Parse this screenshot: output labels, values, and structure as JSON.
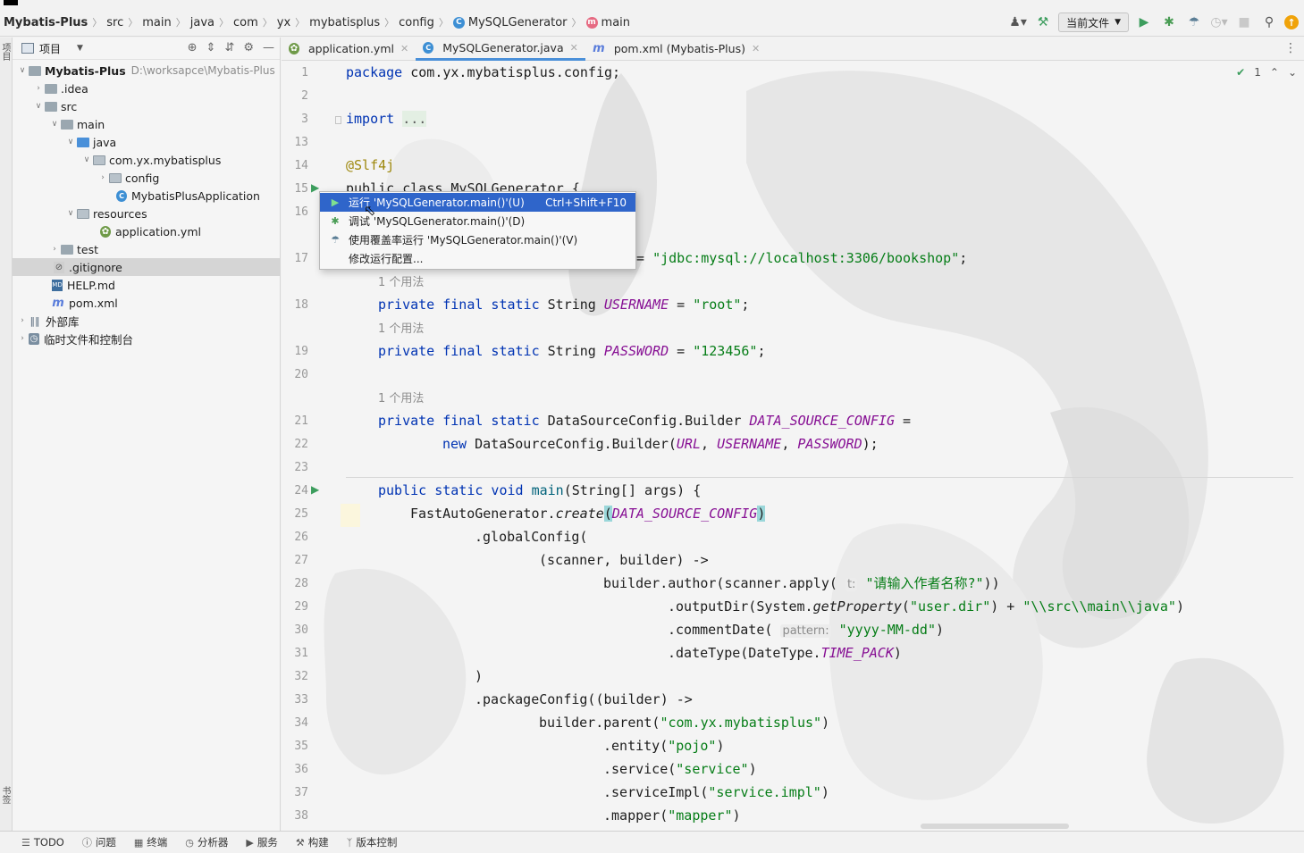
{
  "breadcrumbs": [
    "Mybatis-Plus",
    "src",
    "main",
    "java",
    "com",
    "yx",
    "mybatisplus",
    "config",
    "MySQLGenerator",
    "main"
  ],
  "toolbar": {
    "run_config": "当前文件"
  },
  "left_stripe": {
    "project_tab": "项目",
    "bookmarks_tab": "书签"
  },
  "project_panel": {
    "title": "项目",
    "root_name": "Mybatis-Plus",
    "root_path": "D:\\worksapce\\Mybatis-Plus",
    "items": [
      {
        "label": ".idea"
      },
      {
        "label": "src"
      },
      {
        "label": "main"
      },
      {
        "label": "java"
      },
      {
        "label": "com.yx.mybatisplus"
      },
      {
        "label": "config"
      },
      {
        "label": "MybatisPlusApplication"
      },
      {
        "label": "resources"
      },
      {
        "label": "application.yml"
      },
      {
        "label": "test"
      },
      {
        "label": ".gitignore"
      },
      {
        "label": "HELP.md"
      },
      {
        "label": "pom.xml"
      },
      {
        "label": "外部库"
      },
      {
        "label": "临时文件和控制台"
      }
    ]
  },
  "tabs": [
    {
      "label": "application.yml"
    },
    {
      "label": "MySQLGenerator.java"
    },
    {
      "label": "pom.xml (Mybatis-Plus)"
    }
  ],
  "inspection": {
    "count": "1"
  },
  "line_numbers": [
    "1",
    "2",
    "3",
    "13",
    "14",
    "15",
    "16",
    "17",
    "18",
    "19",
    "20",
    "21",
    "22",
    "23",
    "24",
    "25",
    "26",
    "27",
    "28",
    "29",
    "30",
    "31",
    "32",
    "33",
    "34",
    "35",
    "36",
    "37",
    "38"
  ],
  "code": {
    "l1_kw": "package",
    "l1_rest": " com.yx.mybatisplus.config;",
    "l3_kw": "import",
    "l3_dots": "...",
    "l14": "@Slf4j",
    "l15": "public class MySQLGenerator {",
    "l17_rest": "= ",
    "l17_str": "\"jdbc:mysql://localhost:3306/bookshop\"",
    "l17_end": ";",
    "usage_hint": "1 个用法",
    "l18_kw": "private final static",
    "l18_type": " String ",
    "l18_const": "USERNAME",
    "l18_eq": " = ",
    "l18_str": "\"root\"",
    "l18_end": ";",
    "l19_const": "PASSWORD",
    "l19_str": "\"123456\"",
    "l21_type": " DataSourceConfig.Builder ",
    "l21_const": "DATA_SOURCE_CONFIG",
    "l21_eq": " =",
    "l22_kw": "new",
    "l22_call": " DataSourceConfig.Builder(",
    "l22_a1": "URL",
    "l22_a2": "USERNAME",
    "l22_a3": "PASSWORD",
    "l22_end": ");",
    "l24_kw": "public static void",
    "l24_fn": "main",
    "l24_rest": "(String[] args) {",
    "l25_a": "FastAutoGenerator.",
    "l25_b": "create",
    "l25_c": "(",
    "l25_d": "DATA_SOURCE_CONFIG",
    "l25_e": ")",
    "l26": ".globalConfig(",
    "l27": "(scanner, builder) ->",
    "l28_a": "builder.author(scanner.apply(",
    "l28_hint": "t:",
    "l28_str": "\"请输入作者名称?\"",
    "l28_end": "))",
    "l29_a": ".outputDir(System.",
    "l29_b": "getProperty",
    "l29_c": "(",
    "l29_str1": "\"user.dir\"",
    "l29_d": ") + ",
    "l29_str2": "\"\\\\src\\\\main\\\\java\"",
    "l29_end": ")",
    "l30_a": ".commentDate(",
    "l30_hint": "pattern:",
    "l30_str": "\"yyyy-MM-dd\"",
    "l30_end": ")",
    "l31_a": ".dateType(DateType.",
    "l31_b": "TIME_PACK",
    "l31_end": ")",
    "l32": ")",
    "l33": ".packageConfig((builder) ->",
    "l34_a": "builder.parent(",
    "l34_str": "\"com.yx.mybatisplus\"",
    "l34_end": ")",
    "l35_a": ".entity(",
    "l35_str": "\"pojo\"",
    "l35_end": ")",
    "l36_a": ".service(",
    "l36_str": "\"service\"",
    "l36_end": ")",
    "l37_a": ".serviceImpl(",
    "l37_str": "\"service.impl\"",
    "l37_end": ")",
    "l38_a": ".mapper(",
    "l38_str": "\"mapper\"",
    "l38_end": ")"
  },
  "context_menu": {
    "run": "运行 'MySQLGenerator.main()'(U)",
    "run_shortcut": "Ctrl+Shift+F10",
    "debug": "调试 'MySQLGenerator.main()'(D)",
    "coverage": "使用覆盖率运行 'MySQLGenerator.main()'(V)",
    "modify": "修改运行配置..."
  },
  "status_bar": [
    "TODO",
    "问题",
    "终端",
    "分析器",
    "服务",
    "构建",
    "版本控制"
  ],
  "colors": {
    "accent": "#2f65ca",
    "keyword": "#0033b3",
    "string": "#067d17",
    "constant": "#871094",
    "run_green": "#3c9d5d"
  }
}
